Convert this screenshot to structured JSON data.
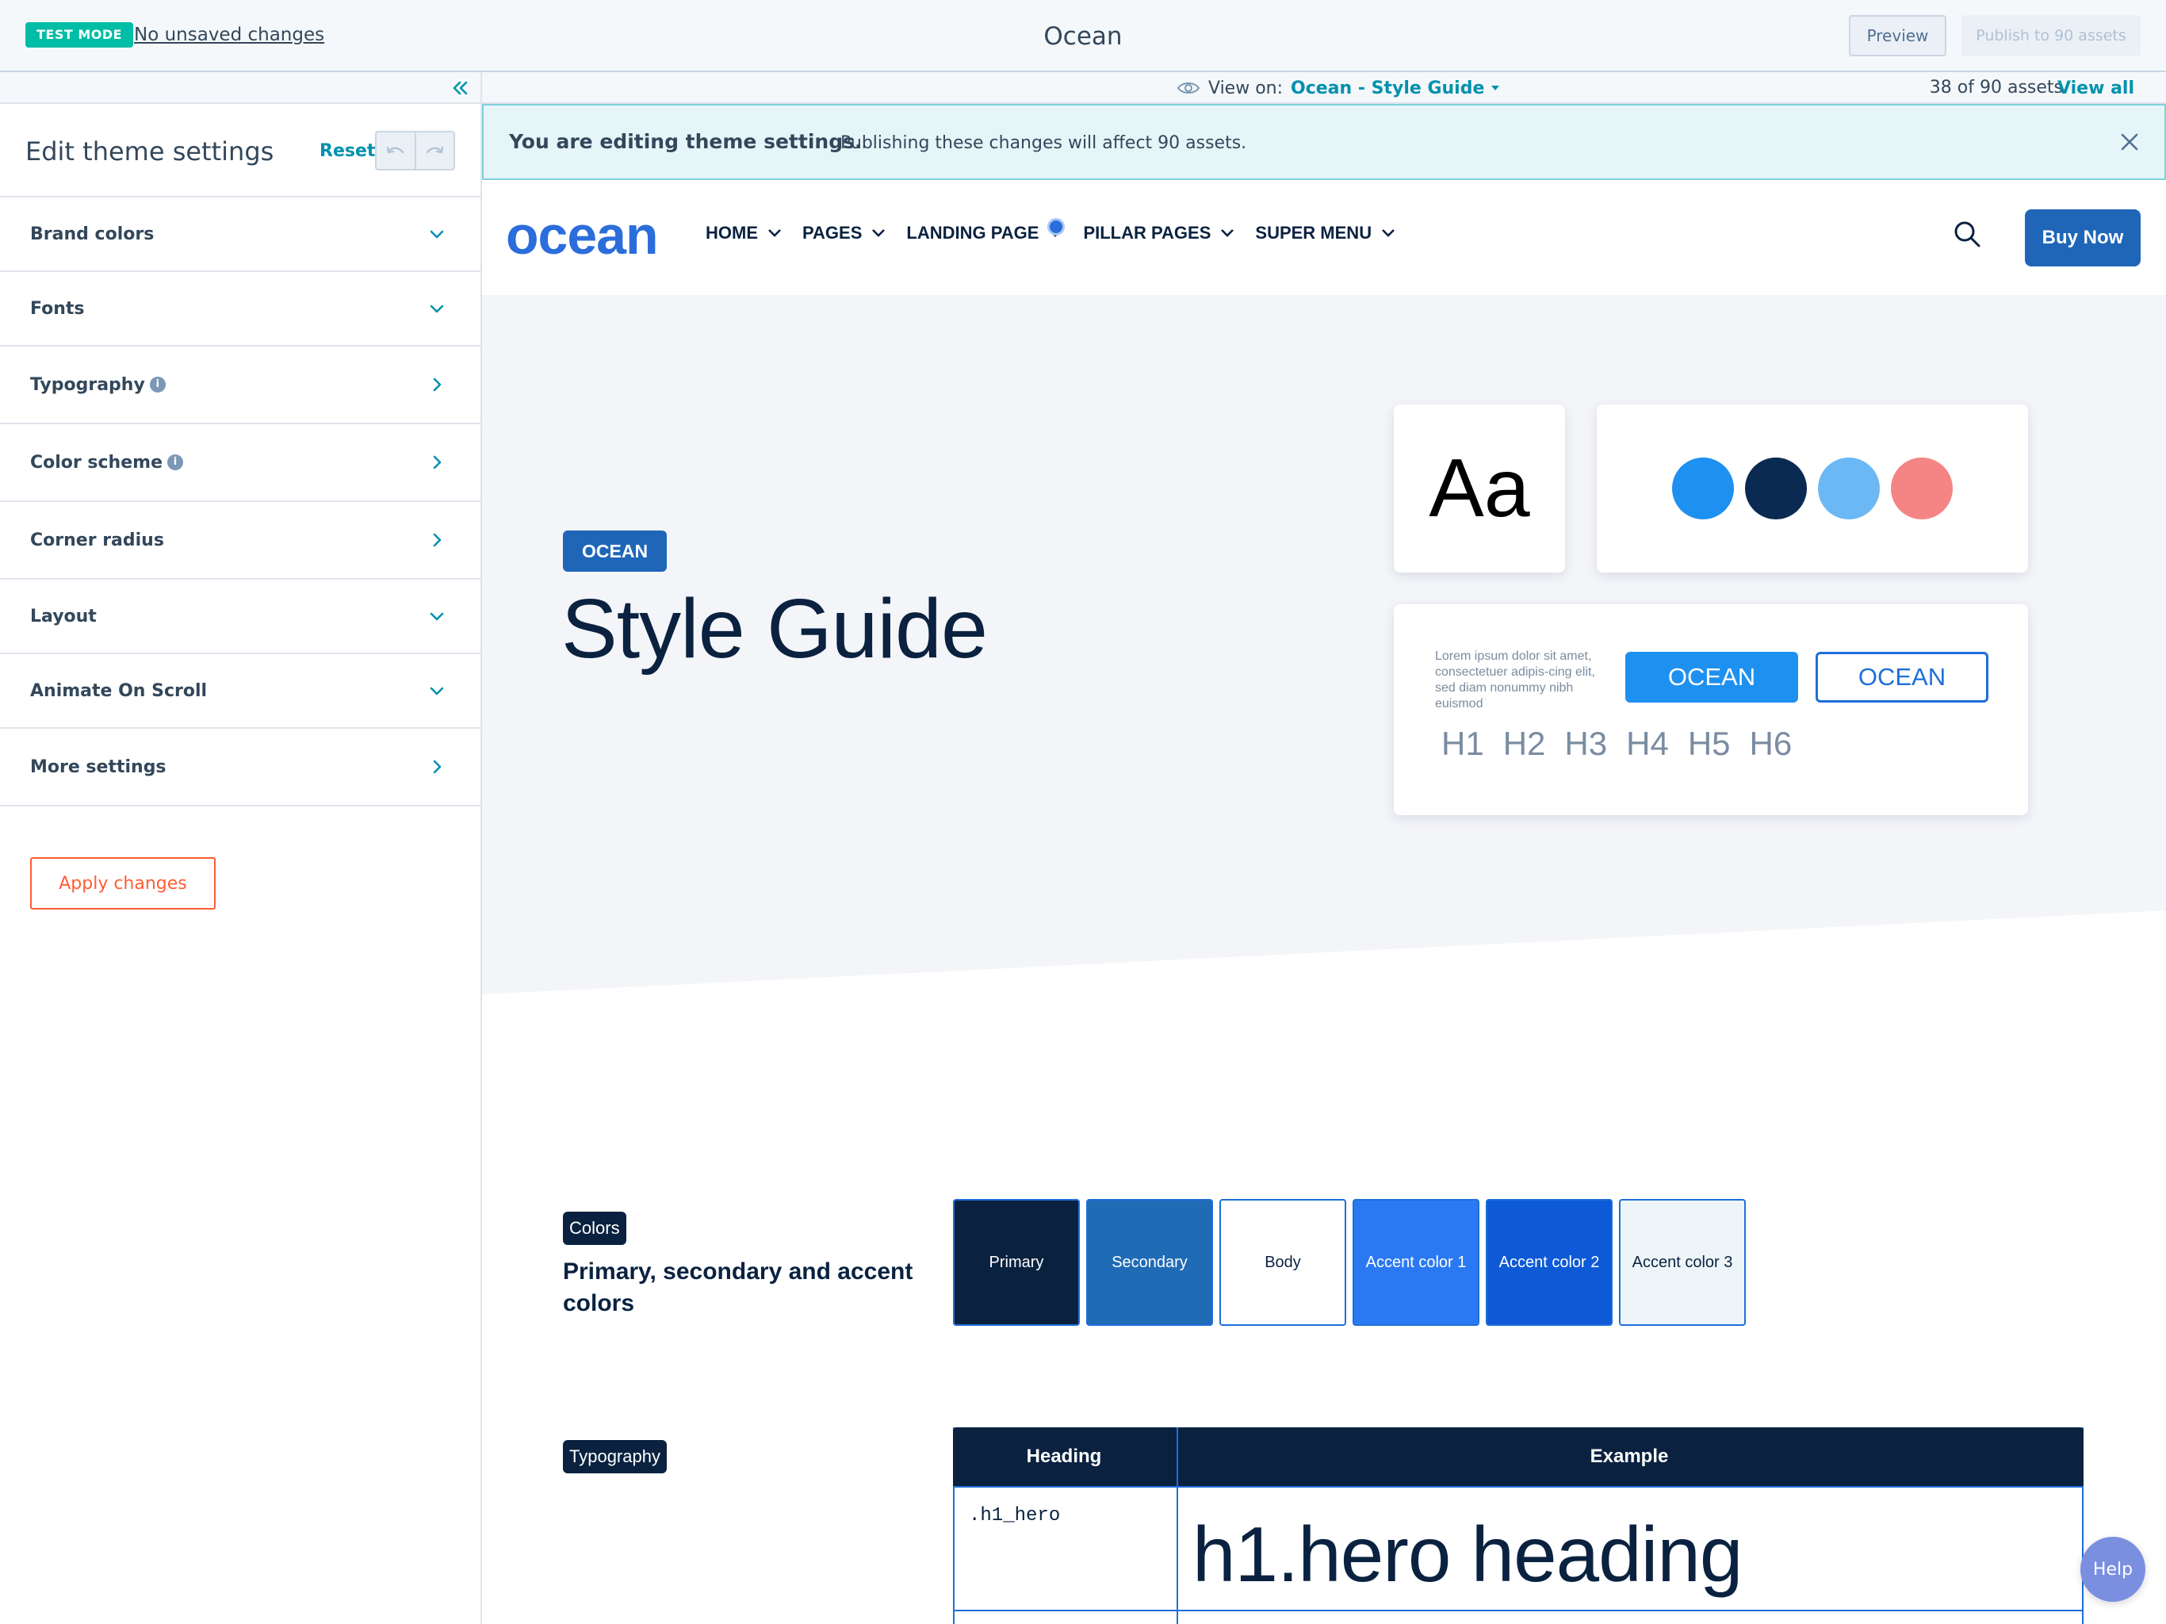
{
  "topbar": {
    "test_mode_badge": "TEST MODE",
    "unsaved_status": "No unsaved changes",
    "title": "Ocean",
    "preview_label": "Preview",
    "publish_label": "Publish to 90 assets"
  },
  "sidebar": {
    "title": "Edit theme settings",
    "reset_label": "Reset",
    "items": [
      {
        "label": "Brand colors",
        "expanded_style": "chevron-down",
        "info": false
      },
      {
        "label": "Fonts",
        "expanded_style": "chevron-down",
        "info": false
      },
      {
        "label": "Typography",
        "expanded_style": "chevron-right",
        "info": true
      },
      {
        "label": "Color scheme",
        "expanded_style": "chevron-right",
        "info": true
      },
      {
        "label": "Corner radius",
        "expanded_style": "chevron-right",
        "info": false
      },
      {
        "label": "Layout",
        "expanded_style": "chevron-down",
        "info": false
      },
      {
        "label": "Animate On Scroll",
        "expanded_style": "chevron-down",
        "info": false
      },
      {
        "label": "More settings",
        "expanded_style": "chevron-right",
        "info": false
      }
    ],
    "apply_label": "Apply changes"
  },
  "viewstrip": {
    "view_on_label": "View on:",
    "current_page": "Ocean - Style Guide",
    "assets_count": "38 of 90 assets",
    "view_all_label": "View all"
  },
  "notice": {
    "title": "You are editing theme settings.",
    "body": "Publishing these changes will affect 90 assets."
  },
  "site": {
    "logo": "ocean",
    "nav": [
      "HOME",
      "PAGES",
      "LANDING PAGE",
      "PILLAR PAGES",
      "SUPER MENU"
    ],
    "buy_label": "Buy Now",
    "hero_tag": "OCEAN",
    "hero_title": "Style Guide",
    "aa_sample": "Aa",
    "palette": [
      "#1e90f0",
      "#0a2a52",
      "#6bb8f5",
      "#f58585"
    ],
    "lorem": "Lorem ipsum dolor sit amet, consectetuer adipis-cing elit, sed diam nonummy nibh euismod",
    "button_solid": "OCEAN",
    "button_outline": "OCEAN",
    "headings": [
      "H1",
      "H2",
      "H3",
      "H4",
      "H5",
      "H6"
    ]
  },
  "colors_section": {
    "tag": "Colors",
    "heading": "Primary, secondary and accent colors",
    "swatches": [
      {
        "label": "Primary",
        "bg": "#0a2240",
        "fg": "#ffffff"
      },
      {
        "label": "Secondary",
        "bg": "#1f6bb5",
        "fg": "#ffffff"
      },
      {
        "label": "Body",
        "bg": "#ffffff",
        "fg": "#0a2240"
      },
      {
        "label": "Accent color 1",
        "bg": "#2b79f2",
        "fg": "#ffffff"
      },
      {
        "label": "Accent color 2",
        "bg": "#0e5ad6",
        "fg": "#ffffff"
      },
      {
        "label": "Accent color 3",
        "bg": "#eef5f8",
        "fg": "#0a2240"
      }
    ]
  },
  "typography_section": {
    "tag": "Typography",
    "col_heading": "Heading",
    "col_example": "Example",
    "row_code": ".h1_hero",
    "row_example": "h1.hero heading"
  },
  "help_label": "Help"
}
